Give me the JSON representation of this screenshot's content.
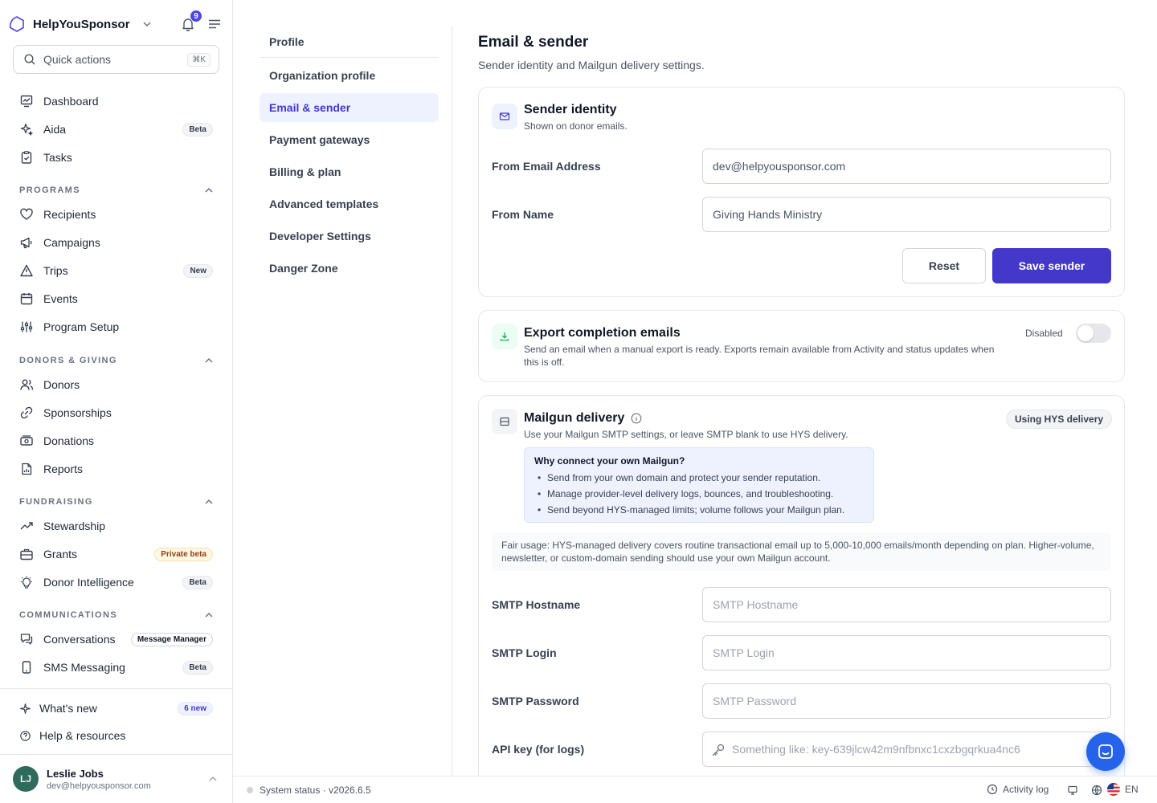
{
  "brand": {
    "name": "HelpYouSponsor",
    "notifications_count": "9"
  },
  "search": {
    "label": "Quick actions",
    "shortcut": "⌘K"
  },
  "nav": {
    "top": [
      {
        "label": "Dashboard",
        "icon": "dashboard-icon"
      },
      {
        "label": "Aida",
        "badge": "Beta",
        "icon": "sparkles-icon"
      },
      {
        "label": "Tasks",
        "icon": "clipboard-icon"
      }
    ],
    "programs": {
      "title": "PROGRAMS",
      "items": [
        {
          "label": "Recipients",
          "icon": "heart-icon"
        },
        {
          "label": "Campaigns",
          "icon": "megaphone-icon"
        },
        {
          "label": "Trips",
          "badge": "New",
          "icon": "triangle-alert-icon"
        },
        {
          "label": "Events",
          "icon": "calendar-icon"
        },
        {
          "label": "Program Setup",
          "icon": "sliders-icon"
        }
      ]
    },
    "donors": {
      "title": "DONORS & GIVING",
      "items": [
        {
          "label": "Donors",
          "icon": "users-icon"
        },
        {
          "label": "Sponsorships",
          "icon": "link-icon"
        },
        {
          "label": "Donations",
          "icon": "banknote-icon"
        },
        {
          "label": "Reports",
          "icon": "report-icon"
        }
      ]
    },
    "fundraising": {
      "title": "FUNDRAISING",
      "items": [
        {
          "label": "Stewardship",
          "icon": "trending-up-icon"
        },
        {
          "label": "Grants",
          "badge": "Private beta",
          "icon": "briefcase-icon"
        },
        {
          "label": "Donor Intelligence",
          "badge": "Beta",
          "icon": "lightbulb-icon"
        }
      ]
    },
    "communications": {
      "title": "COMMUNICATIONS",
      "items": [
        {
          "label": "Conversations",
          "badge": "Message Manager",
          "icon": "chat-icon"
        },
        {
          "label": "SMS Messaging",
          "badge": "Beta",
          "icon": "smartphone-icon"
        }
      ]
    },
    "bottom": [
      {
        "label": "What's new",
        "badge": "6 new",
        "icon": "sparkle-icon"
      },
      {
        "label": "Help & resources",
        "icon": "help-circle-icon"
      }
    ]
  },
  "user": {
    "initials": "LJ",
    "name": "Leslie Jobs",
    "email": "dev@helpyousponsor.com"
  },
  "settings_nav": {
    "header": "Profile",
    "items": [
      "Organization profile",
      "Email & sender",
      "Payment gateways",
      "Billing & plan",
      "Advanced templates",
      "Developer Settings",
      "Danger Zone"
    ],
    "active": "Email & sender"
  },
  "page": {
    "title": "Email & sender",
    "subtitle": "Sender identity and Mailgun delivery settings."
  },
  "sender": {
    "title": "Sender identity",
    "desc": "Shown on donor emails.",
    "from_email_label": "From Email Address",
    "from_email_value": "dev@helpyousponsor.com",
    "from_name_label": "From Name",
    "from_name_value": "Giving Hands Ministry",
    "reset": "Reset",
    "save": "Save sender"
  },
  "export": {
    "title": "Export completion emails",
    "desc": "Send an email when a manual export is ready. Exports remain available from Activity and status updates when this is off.",
    "toggle_label": "Disabled",
    "enabled": false
  },
  "mailgun": {
    "title": "Mailgun delivery",
    "desc": "Use your Mailgun SMTP settings, or leave SMTP blank to use HYS delivery.",
    "status_badge": "Using HYS delivery",
    "why_title": "Why connect your own Mailgun?",
    "why_points": [
      "Send from your own domain and protect your sender reputation.",
      "Manage provider-level delivery logs, bounces, and troubleshooting.",
      "Send beyond HYS-managed limits; volume follows your Mailgun plan."
    ],
    "fair_usage": "Fair usage: HYS-managed delivery covers routine transactional email up to 5,000-10,000 emails/month depending on plan. Higher-volume, newsletter, or custom-domain sending should use your own Mailgun account.",
    "host_label": "SMTP Hostname",
    "host_placeholder": "SMTP Hostname",
    "login_label": "SMTP Login",
    "login_placeholder": "SMTP Login",
    "password_label": "SMTP Password",
    "password_placeholder": "SMTP Password",
    "apikey_label": "API key (for logs)",
    "apikey_placeholder": "Something like: key-639jlcw42m9nfbnxc1cxzbgqrkua4nc6"
  },
  "footer": {
    "status": "System status · v2026.6.5",
    "activity": "Activity log",
    "lang": "EN"
  },
  "colors": {
    "accent": "#4338ca",
    "active_bg": "#eef2ff",
    "chat": "#2563eb"
  }
}
